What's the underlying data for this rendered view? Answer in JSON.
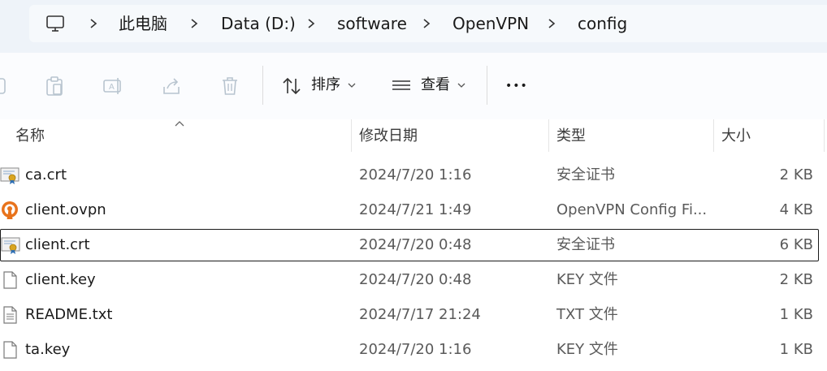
{
  "breadcrumb": {
    "items": [
      {
        "label": "此电脑"
      },
      {
        "label": "Data (D:)"
      },
      {
        "label": "software"
      },
      {
        "label": "OpenVPN"
      },
      {
        "label": "config"
      }
    ]
  },
  "toolbar": {
    "sort_label": "排序",
    "view_label": "查看",
    "more_label": "•••"
  },
  "columns": {
    "name": "名称",
    "date": "修改日期",
    "type": "类型",
    "size": "大小"
  },
  "files": [
    {
      "name": "ca.crt",
      "date": "2024/7/20 1:16",
      "type": "安全证书",
      "size": "2 KB",
      "icon": "certificate-icon"
    },
    {
      "name": "client.ovpn",
      "date": "2024/7/21 1:49",
      "type": "OpenVPN Config Fi...",
      "size": "4 KB",
      "icon": "openvpn-icon"
    },
    {
      "name": "client.crt",
      "date": "2024/7/20 0:48",
      "type": "安全证书",
      "size": "6 KB",
      "icon": "certificate-icon",
      "selected": true
    },
    {
      "name": "client.key",
      "date": "2024/7/20 0:48",
      "type": "KEY 文件",
      "size": "2 KB",
      "icon": "blank-file-icon"
    },
    {
      "name": "README.txt",
      "date": "2024/7/17 21:24",
      "type": "TXT 文件",
      "size": "1 KB",
      "icon": "text-file-icon"
    },
    {
      "name": "ta.key",
      "date": "2024/7/20 1:16",
      "type": "KEY 文件",
      "size": "1 KB",
      "icon": "blank-file-icon"
    }
  ],
  "colors": {
    "accent_orange": "#e8731c",
    "cert_gold": "#d9a520",
    "selection_border": "#1a1a1a"
  }
}
